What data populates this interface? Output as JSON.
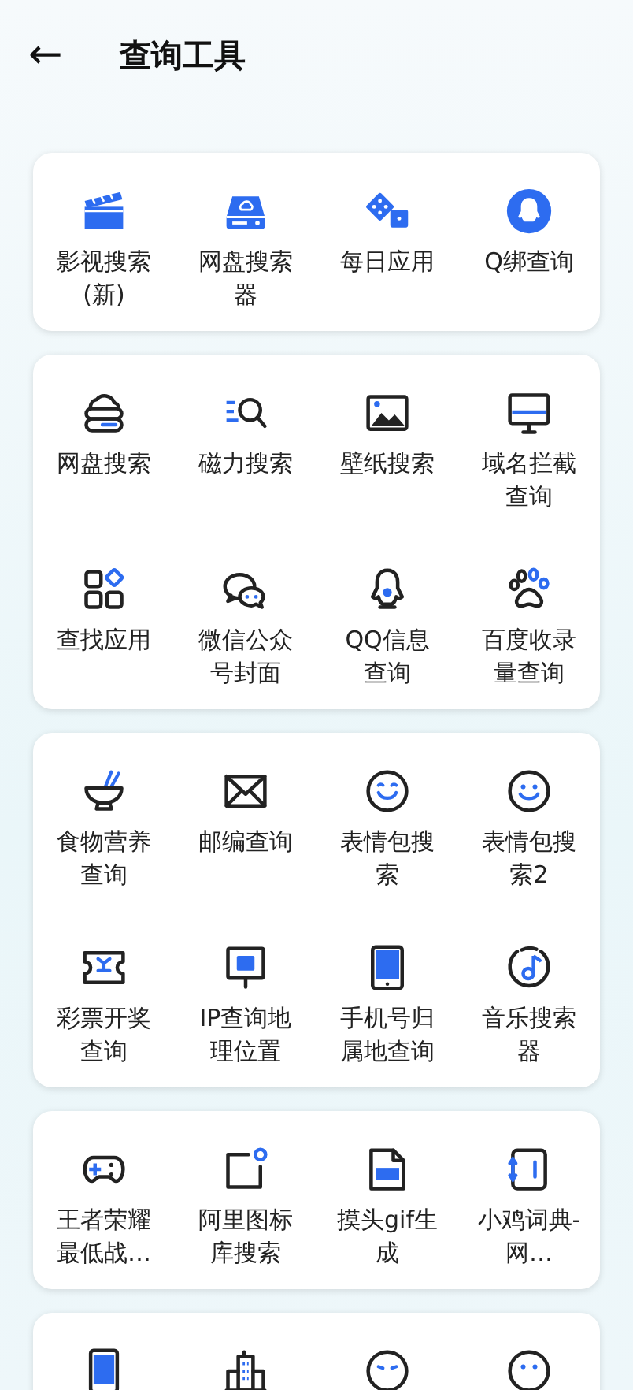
{
  "header": {
    "back": "←",
    "title": "查询工具"
  },
  "sections": [
    {
      "items": [
        {
          "kind": "tool",
          "label": "影视搜索(新)"
        },
        {
          "kind": "tool",
          "label": "网盘搜索器"
        },
        {
          "kind": "tool",
          "label": "每日应用"
        },
        {
          "kind": "tool",
          "label": "Q绑查询"
        }
      ]
    },
    {
      "items": [
        {
          "kind": "tool",
          "label": "网盘搜索"
        },
        {
          "kind": "tool",
          "label": "磁力搜索"
        },
        {
          "kind": "tool",
          "label": "壁纸搜索"
        },
        {
          "kind": "tool",
          "label": "域名拦截查询"
        },
        {
          "kind": "tool",
          "label": "查找应用"
        },
        {
          "kind": "tool",
          "label": "微信公众号封面"
        },
        {
          "kind": "tool",
          "label": "QQ信息查询"
        },
        {
          "kind": "tool",
          "label": "百度收录量查询"
        }
      ]
    },
    {
      "items": [
        {
          "kind": "tool",
          "label": "食物营养查询"
        },
        {
          "kind": "tool",
          "label": "邮编查询"
        },
        {
          "kind": "tool",
          "label": "表情包搜索"
        },
        {
          "kind": "tool",
          "label": "表情包搜索2"
        },
        {
          "kind": "tool",
          "label": "彩票开奖查询"
        },
        {
          "kind": "tool",
          "label": "IP查询地理位置"
        },
        {
          "kind": "tool",
          "label": "手机号归属地查询"
        },
        {
          "kind": "tool",
          "label": "音乐搜索器"
        }
      ]
    },
    {
      "items": [
        {
          "kind": "tool",
          "label": "王者荣耀最低战…"
        },
        {
          "kind": "tool",
          "label": "阿里图标库搜索"
        },
        {
          "kind": "tool",
          "label": "摸头gif生成"
        },
        {
          "kind": "tool",
          "label": "小鸡词典-网…"
        }
      ]
    },
    {
      "items": [
        {
          "kind": "partial"
        },
        {
          "kind": "partial"
        },
        {
          "kind": "partial"
        },
        {
          "kind": "partial"
        }
      ]
    }
  ]
}
